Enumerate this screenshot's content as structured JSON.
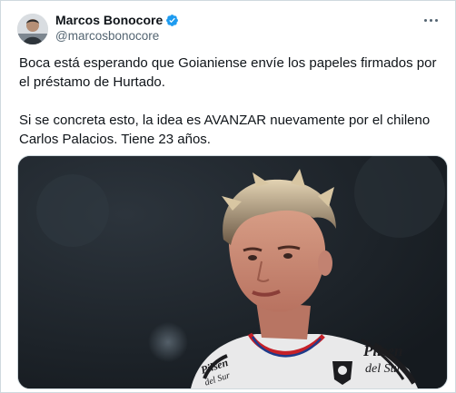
{
  "author": {
    "display_name": "Marcos Bonocore",
    "handle": "@marcosbonocore",
    "verified": true
  },
  "tweet": {
    "paragraphs": [
      "Boca está esperando que Goianiense envíe los papeles firmados por el préstamo de Hurtado.",
      "Si se concreta esto, la idea es AVANZAR nuevamente por el chileno Carlos Palacios. Tiene 23 años."
    ]
  },
  "media": {
    "jersey_sponsor": "Pilsen del Sur"
  },
  "colors": {
    "verified": "#1d9bf0",
    "muted_text": "#536471",
    "border": "#cfd9de"
  },
  "icons": {
    "verified": "verified-badge-icon",
    "more": "more-options-icon"
  }
}
